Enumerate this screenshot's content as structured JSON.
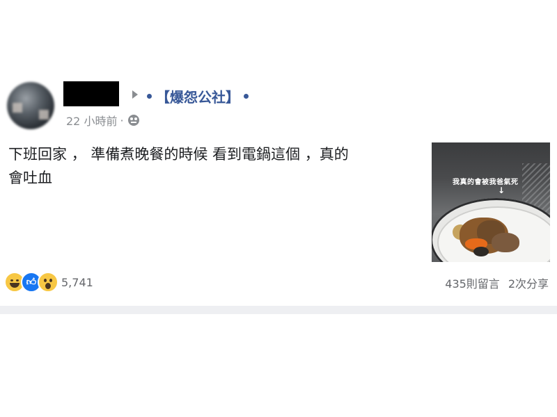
{
  "post": {
    "group_name": "【爆怨公社】",
    "time_ago": "22 小時前",
    "separator": "·",
    "text_lines": [
      "下班回家 ， 準備煮晚餐的時候 看到電鍋這個 ，真的",
      "會吐血"
    ],
    "thumbnail": {
      "caption": "我真的會被我爸氣死",
      "arrow": "↓"
    },
    "reactions": {
      "icons": [
        "haha-icon",
        "like-icon",
        "wow-icon"
      ],
      "count": "5,741"
    },
    "comments_label": "435則留言",
    "shares_label": "2次分享"
  },
  "colors": {
    "link_blue": "#385898",
    "meta_gray": "#8a8d91",
    "text_dark": "#1c1e21",
    "like_blue": "#1877f2",
    "emoji_yellow": "#f7c744"
  }
}
